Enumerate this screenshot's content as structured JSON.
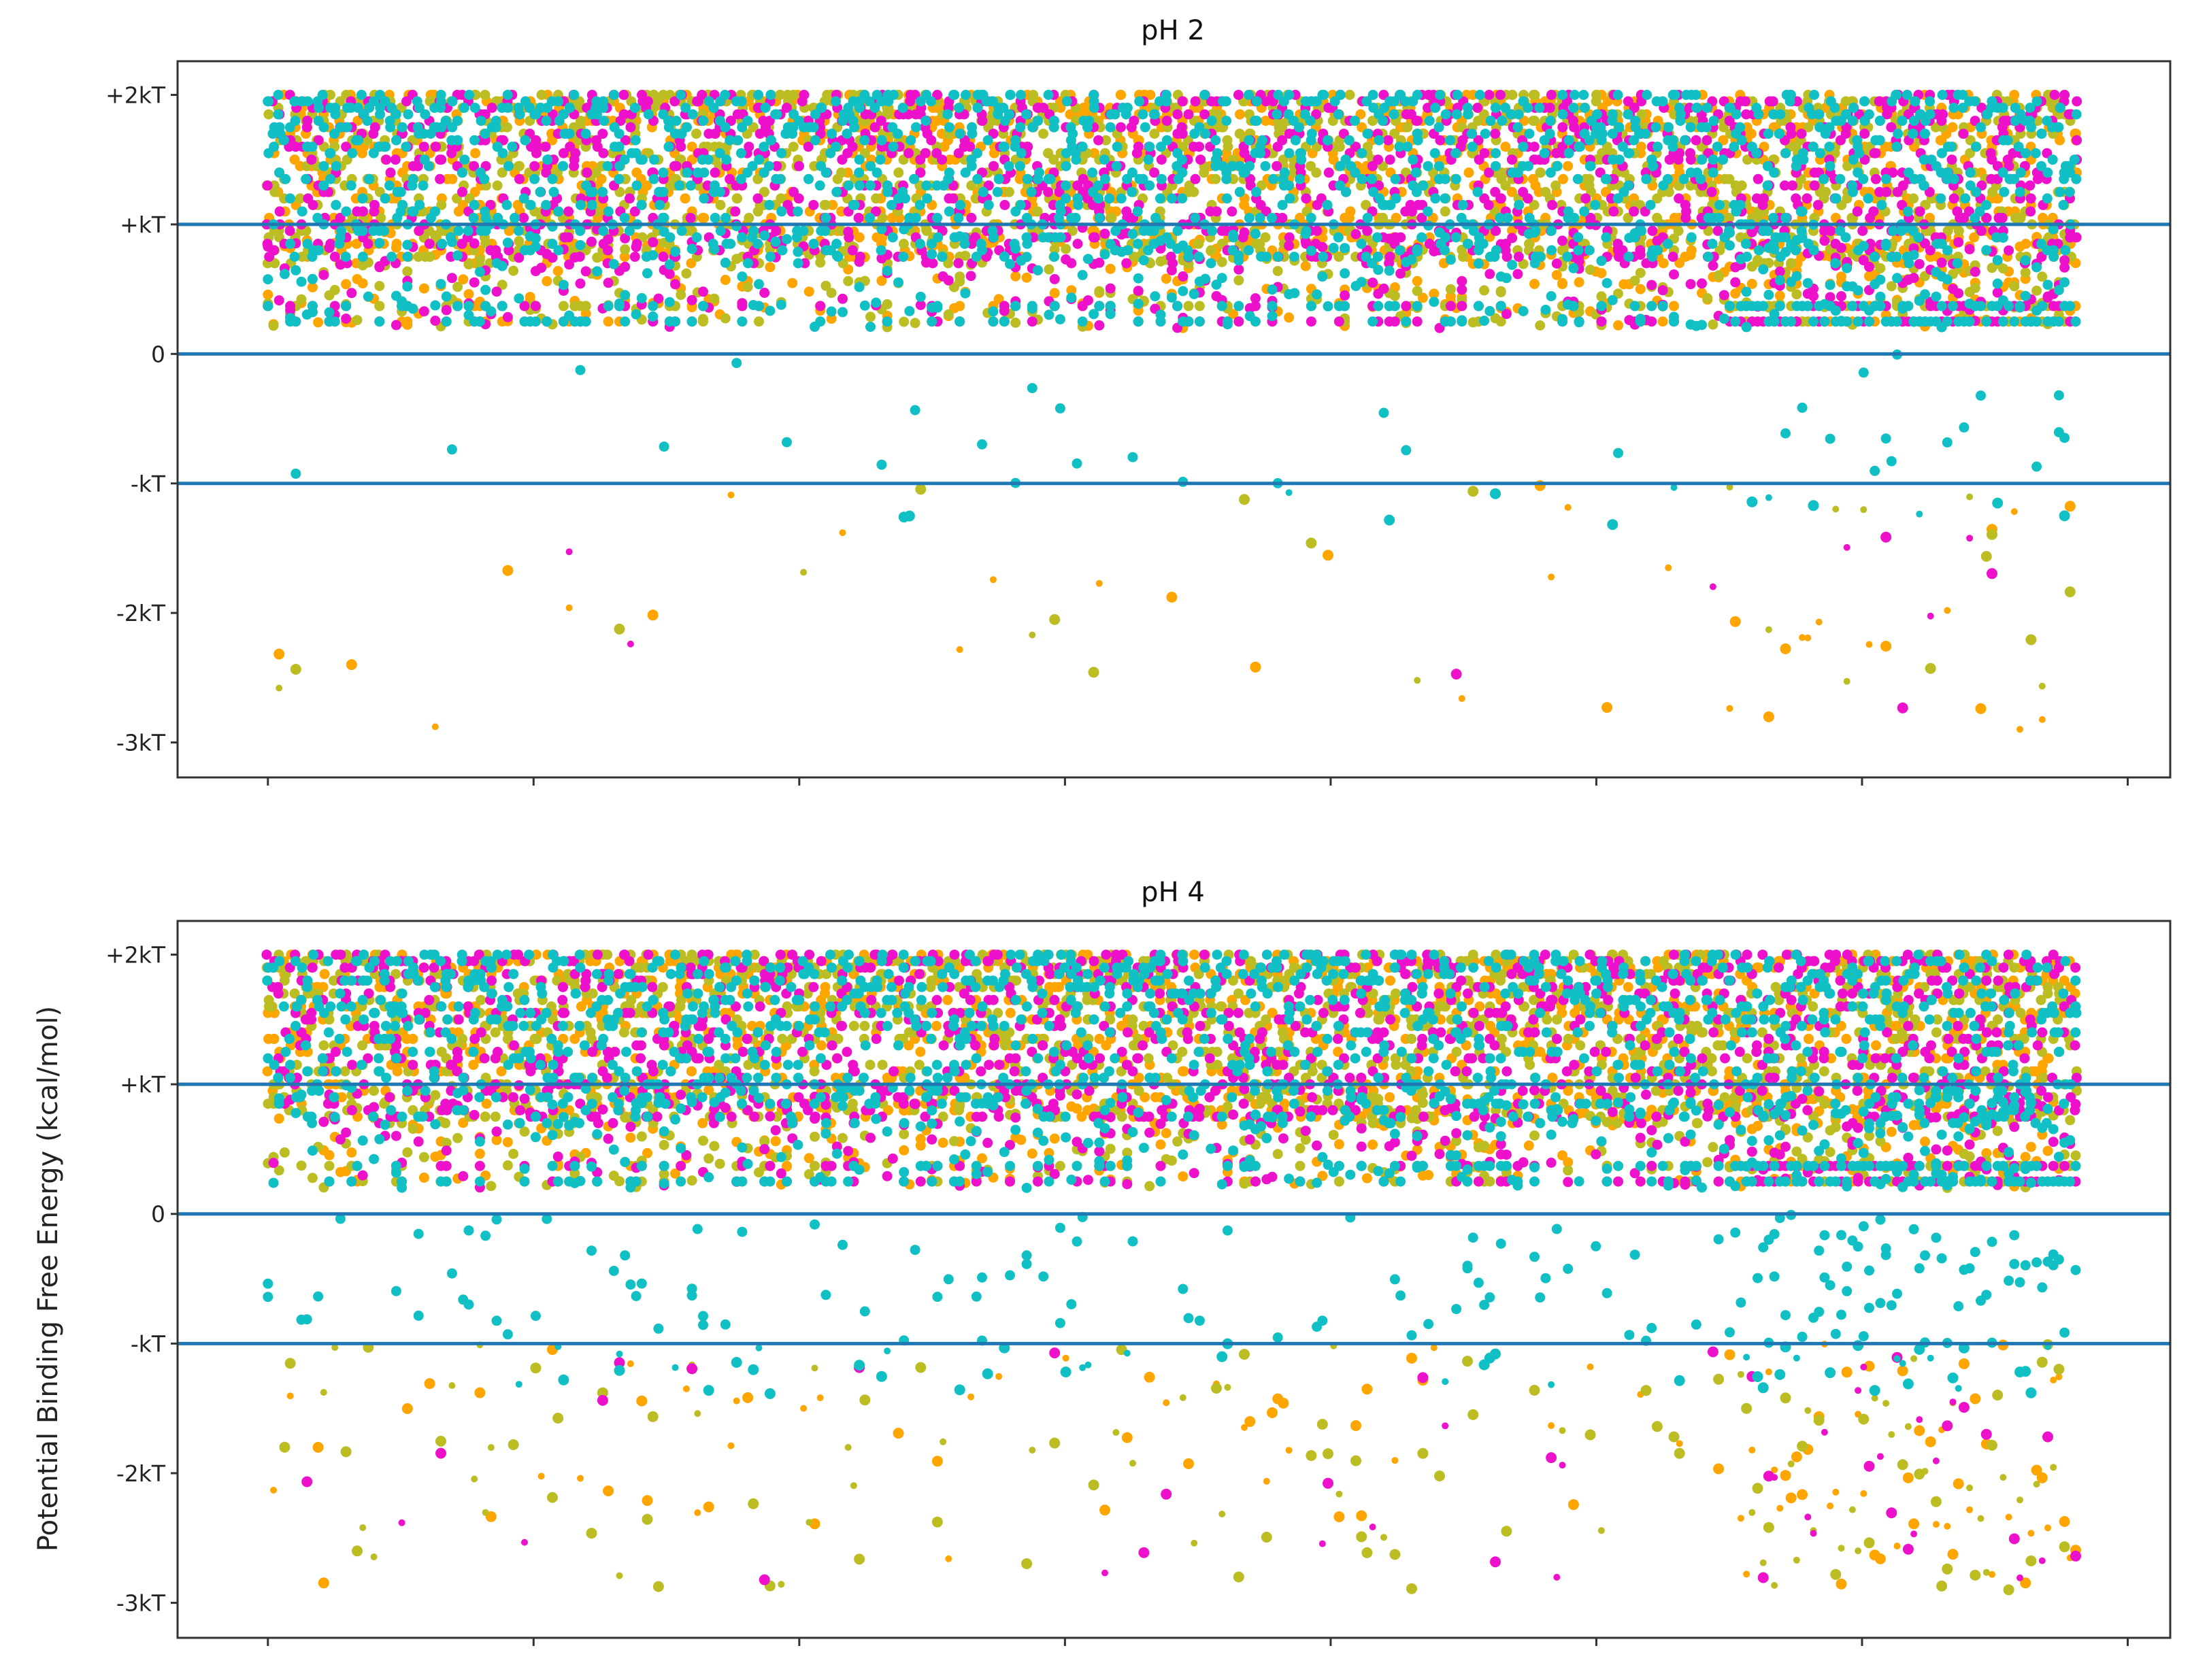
{
  "chart_data": [
    {
      "type": "scatter",
      "title": "pH 2",
      "xlabel": "",
      "ylabel": "",
      "ylim": [
        -3.27,
        2.26
      ],
      "xlim": [
        -0.34,
        7.16
      ],
      "x_ticks": [
        0,
        1,
        2,
        3,
        4,
        5,
        6,
        7
      ],
      "y_ticks": [
        {
          "value": 2,
          "label": "+2kT"
        },
        {
          "value": 1,
          "label": "+kT"
        },
        {
          "value": 0,
          "label": "0"
        },
        {
          "value": -1,
          "label": "-kT"
        },
        {
          "value": -2,
          "label": "-2kT"
        },
        {
          "value": -3,
          "label": "-3kT"
        }
      ],
      "reference_lines": [
        1,
        0,
        -1
      ],
      "grid": false,
      "x_data_range": [
        0,
        6.82
      ],
      "negative_density": 0.05,
      "dense_region_start": 5.5,
      "seed": 11
    },
    {
      "type": "scatter",
      "title": "pH 4",
      "xlabel": "",
      "ylabel": "Potential Binding Free Energy (kcal/mol)",
      "ylim": [
        -3.27,
        2.26
      ],
      "xlim": [
        -0.34,
        7.16
      ],
      "x_ticks": [
        0,
        1,
        2,
        3,
        4,
        5,
        6,
        7
      ],
      "y_ticks": [
        {
          "value": 2,
          "label": "+2kT"
        },
        {
          "value": 1,
          "label": "+kT"
        },
        {
          "value": 0,
          "label": "0"
        },
        {
          "value": -1,
          "label": "-kT"
        },
        {
          "value": -2,
          "label": "-2kT"
        },
        {
          "value": -3,
          "label": "-3kT"
        }
      ],
      "reference_lines": [
        1,
        0,
        -1
      ],
      "grid": false,
      "x_data_range": [
        0,
        6.82
      ],
      "negative_density": 0.22,
      "dense_region_start": 5.5,
      "seed": 29
    }
  ],
  "series": [
    {
      "name": "series-orange",
      "color": "#ffa500"
    },
    {
      "name": "series-olive",
      "color": "#bcbd22"
    },
    {
      "name": "series-magenta",
      "color": "#ee11cc"
    },
    {
      "name": "series-cyan",
      "color": "#11c0c4"
    }
  ],
  "reference_line_color": "#1f77b4"
}
